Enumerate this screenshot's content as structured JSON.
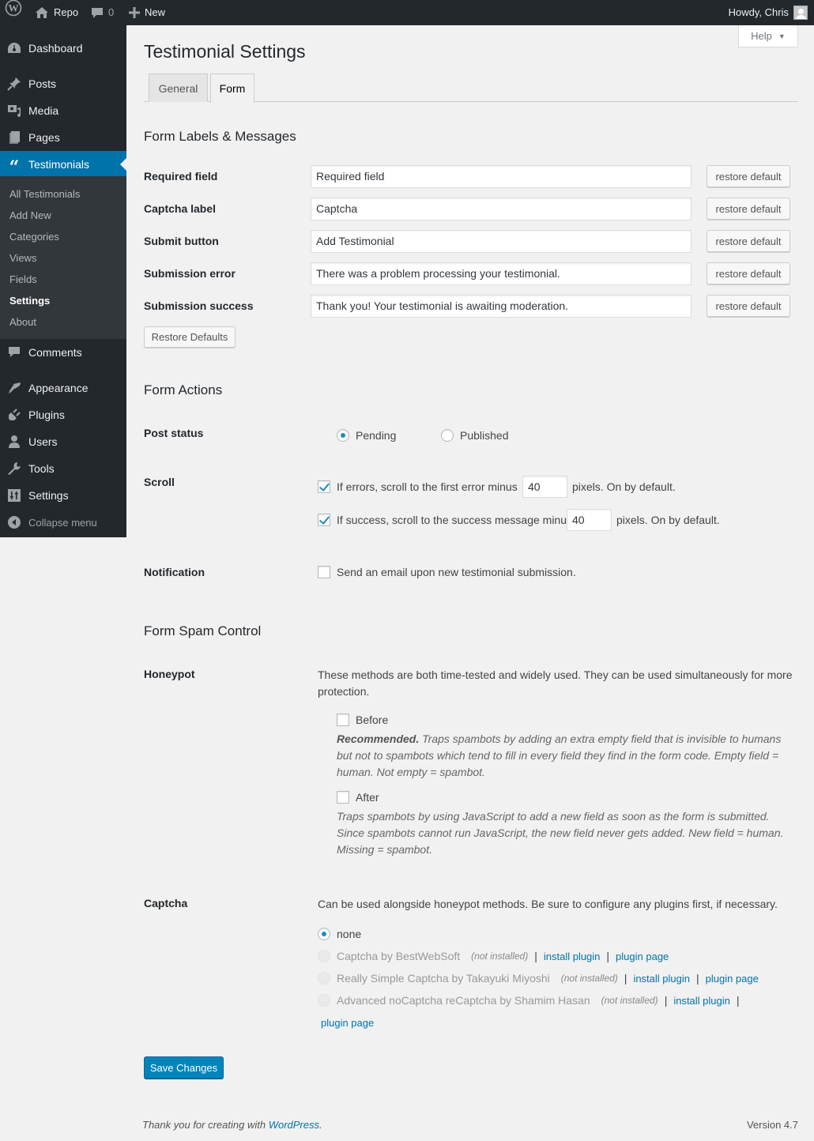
{
  "adminbar": {
    "site_name": "Repo",
    "comments_count": "0",
    "new_label": "New",
    "howdy": "Howdy, Chris"
  },
  "sidebar": {
    "items": [
      {
        "label": "Dashboard",
        "icon": "dashboard-icon"
      },
      {
        "label": "Posts",
        "icon": "pin-icon"
      },
      {
        "label": "Media",
        "icon": "media-icon"
      },
      {
        "label": "Pages",
        "icon": "pages-icon"
      },
      {
        "label": "Testimonials",
        "icon": "quote-icon",
        "active": true
      },
      {
        "label": "Comments",
        "icon": "comment-icon"
      },
      {
        "label": "Appearance",
        "icon": "brush-icon"
      },
      {
        "label": "Plugins",
        "icon": "plugin-icon"
      },
      {
        "label": "Users",
        "icon": "user-icon"
      },
      {
        "label": "Tools",
        "icon": "wrench-icon"
      },
      {
        "label": "Settings",
        "icon": "settings-icon"
      },
      {
        "label": "Collapse menu",
        "icon": "collapse-icon"
      }
    ],
    "submenu": [
      {
        "label": "All Testimonials"
      },
      {
        "label": "Add New"
      },
      {
        "label": "Categories"
      },
      {
        "label": "Views"
      },
      {
        "label": "Fields"
      },
      {
        "label": "Settings",
        "current": true
      },
      {
        "label": "About"
      }
    ]
  },
  "help_label": "Help",
  "page_title": "Testimonial Settings",
  "tabs": [
    {
      "label": "General",
      "active": false
    },
    {
      "label": "Form",
      "active": true
    }
  ],
  "labels_section": {
    "heading": "Form Labels & Messages",
    "fields": [
      {
        "label": "Required field",
        "value": "Required field",
        "button": "restore default"
      },
      {
        "label": "Captcha label",
        "value": "Captcha",
        "button": "restore default"
      },
      {
        "label": "Submit button",
        "value": "Add Testimonial",
        "button": "restore default"
      },
      {
        "label": "Submission error",
        "value": "There was a problem processing your testimonial.",
        "button": "restore default"
      },
      {
        "label": "Submission success",
        "value": "Thank you! Your testimonial is awaiting moderation.",
        "button": "restore default"
      }
    ],
    "restore_all": "Restore Defaults"
  },
  "actions_section": {
    "heading": "Form Actions",
    "post_status": {
      "label": "Post status",
      "options": [
        {
          "label": "Pending",
          "checked": true
        },
        {
          "label": "Published",
          "checked": false
        }
      ]
    },
    "scroll": {
      "label": "Scroll",
      "error": {
        "checked": true,
        "before": "If errors, scroll to the first error minus",
        "value": "40",
        "after": "pixels. On by default."
      },
      "success": {
        "checked": true,
        "before": "If success, scroll to the success message minus",
        "value": "40",
        "after": "pixels. On by default."
      }
    },
    "notification": {
      "label": "Notification",
      "checked": false,
      "text": "Send an email upon new testimonial submission."
    }
  },
  "spam_section": {
    "heading": "Form Spam Control",
    "honeypot": {
      "label": "Honeypot",
      "intro": "These methods are both time-tested and widely used. They can be used simultaneously for more protection.",
      "before": {
        "label": "Before",
        "checked": false,
        "strong": "Recommended.",
        "desc": "Traps spambots by adding an extra empty field that is invisible to humans but not to spambots which tend to fill in every field they find in the form code. Empty field = human. Not empty = spambot."
      },
      "after": {
        "label": "After",
        "checked": false,
        "desc": "Traps spambots by using JavaScript to add a new field as soon as the form is submitted. Since spambots cannot run JavaScript, the new field never gets added. New field = human. Missing = spambot."
      }
    },
    "captcha": {
      "label": "Captcha",
      "intro": "Can be used alongside honeypot methods. Be sure to configure any plugins first, if necessary.",
      "none_label": "none",
      "plugins": [
        {
          "name": "Captcha by BestWebSoft",
          "status": "(not installed)",
          "install": "install plugin",
          "page": "plugin page"
        },
        {
          "name": "Really Simple Captcha by Takayuki Miyoshi",
          "status": "(not installed)",
          "install": "install plugin",
          "page": "plugin page"
        },
        {
          "name": "Advanced noCaptcha reCaptcha by Shamim Hasan",
          "status": "(not installed)",
          "install": "install plugin",
          "page": "plugin page"
        }
      ]
    }
  },
  "save_label": "Save Changes",
  "footer": {
    "thanks": "Thank you for creating with ",
    "link": "WordPress",
    "period": ".",
    "version": "Version 4.7"
  },
  "colors": {
    "admin_bar": "#23282d",
    "active_menu": "#0073aa",
    "primary_button": "#0085ba",
    "link": "#0073aa"
  }
}
